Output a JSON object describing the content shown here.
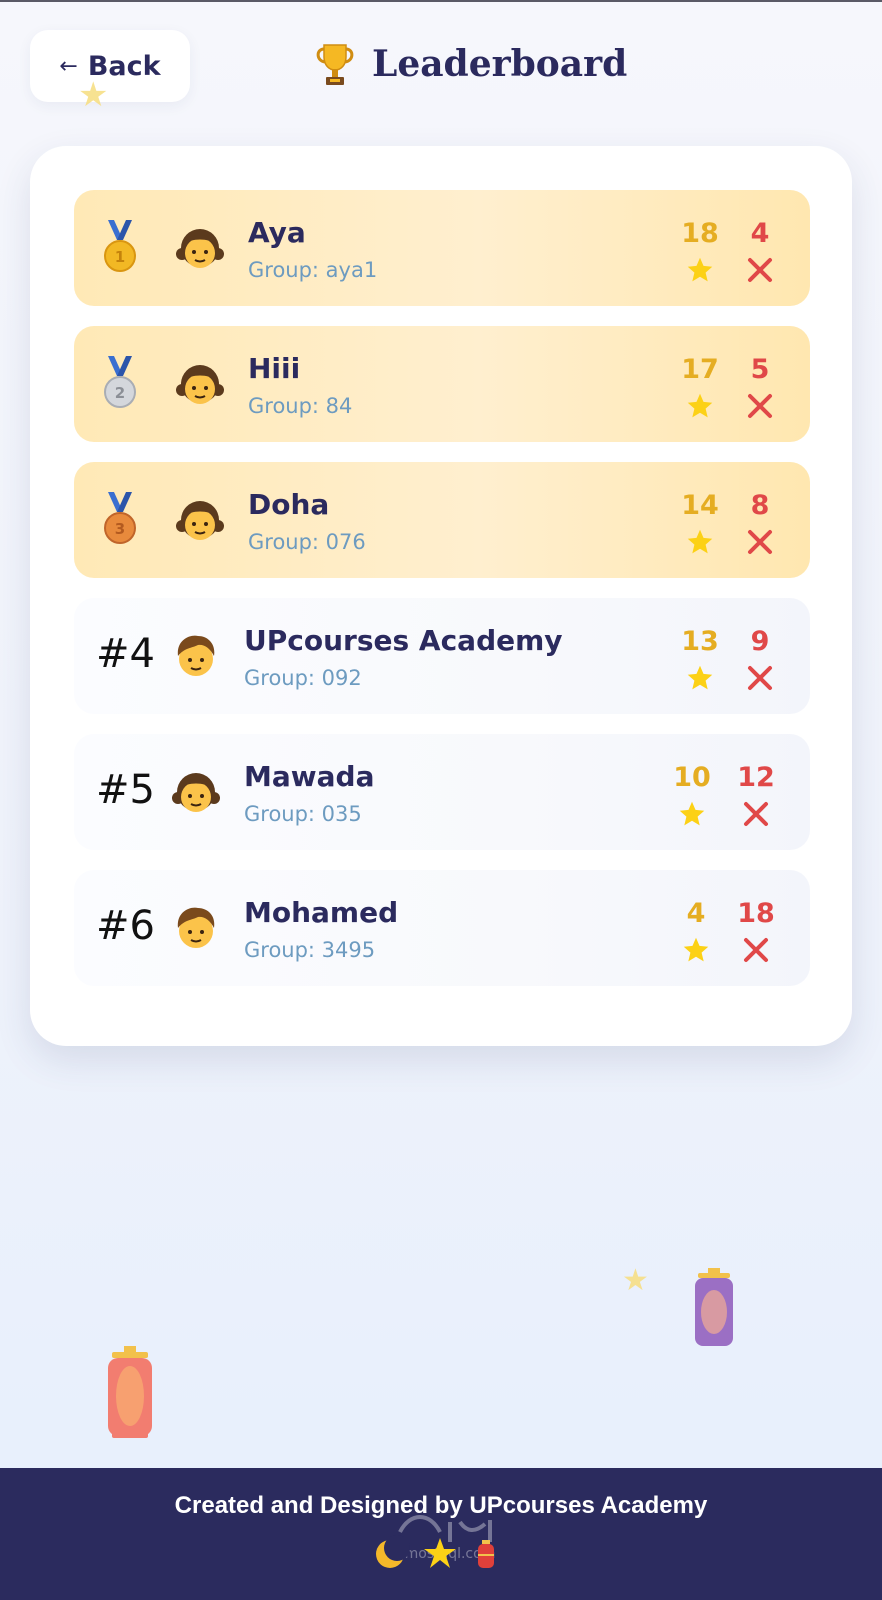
{
  "header": {
    "back_label": "Back",
    "back_arrow": "←",
    "title": "Leaderboard"
  },
  "leaderboard": [
    {
      "rank_label": "",
      "medal": "gold-medal",
      "avatar": "girl",
      "name": "Aya",
      "group": "Group: aya1",
      "stars": "18",
      "wrong": "4"
    },
    {
      "rank_label": "",
      "medal": "silver-medal",
      "avatar": "girl",
      "name": "Hiii",
      "group": "Group: 84",
      "stars": "17",
      "wrong": "5"
    },
    {
      "rank_label": "",
      "medal": "bronze-medal",
      "avatar": "girl",
      "name": "Doha",
      "group": "Group: 076",
      "stars": "14",
      "wrong": "8"
    },
    {
      "rank_label": "#4",
      "medal": "",
      "avatar": "boy",
      "name": "UPcourses Academy",
      "group": "Group: 092",
      "stars": "13",
      "wrong": "9"
    },
    {
      "rank_label": "#5",
      "medal": "",
      "avatar": "girl",
      "name": "Mawada",
      "group": "Group: 035",
      "stars": "10",
      "wrong": "12"
    },
    {
      "rank_label": "#6",
      "medal": "",
      "avatar": "boy",
      "name": "Mohamed",
      "group": "Group: 3495",
      "stars": "4",
      "wrong": "18"
    }
  ],
  "footer": {
    "text": "Created and Designed by UPcourses Academy",
    "watermark": "مستقل mostaql.com"
  },
  "colors": {
    "navy": "#2b2b5e",
    "gold": "#e5ad22",
    "red": "#e04848",
    "group_text": "#6d9bc0",
    "top_row_bg": "#ffe9b6"
  }
}
